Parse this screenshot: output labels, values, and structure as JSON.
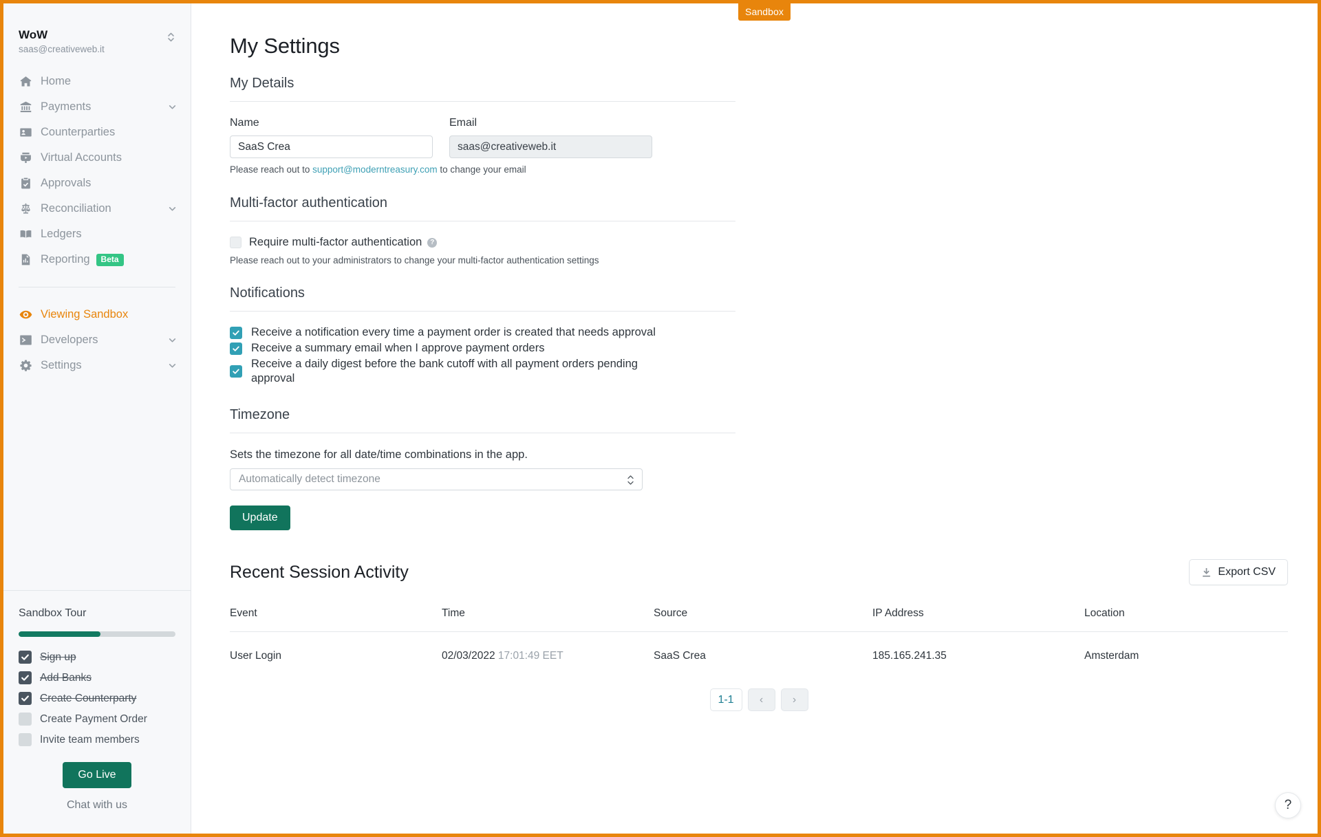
{
  "frame": {
    "sandbox_badge": "Sandbox",
    "accent_orange": "#e8850c",
    "accent_green": "#11745c",
    "accent_teal": "#31a0b5"
  },
  "sidebar": {
    "org": {
      "name": "WoW",
      "email": "saas@creativeweb.it"
    },
    "nav": [
      {
        "label": "Home",
        "icon": "home-icon",
        "chevron": false
      },
      {
        "label": "Payments",
        "icon": "bank-icon",
        "chevron": true
      },
      {
        "label": "Counterparties",
        "icon": "counterparties-icon",
        "chevron": false
      },
      {
        "label": "Virtual Accounts",
        "icon": "virtual-accounts-icon",
        "chevron": false
      },
      {
        "label": "Approvals",
        "icon": "clipboard-check-icon",
        "chevron": false
      },
      {
        "label": "Reconciliation",
        "icon": "scales-icon",
        "chevron": true
      },
      {
        "label": "Ledgers",
        "icon": "book-icon",
        "chevron": false
      },
      {
        "label": "Reporting",
        "icon": "report-icon",
        "chevron": false,
        "badge": "Beta"
      }
    ],
    "nav_secondary": [
      {
        "label": "Viewing Sandbox",
        "icon": "eye-icon",
        "chevron": false,
        "highlight": true
      },
      {
        "label": "Developers",
        "icon": "terminal-icon",
        "chevron": true
      },
      {
        "label": "Settings",
        "icon": "gear-icon",
        "chevron": true
      }
    ],
    "tour": {
      "title": "Sandbox Tour",
      "progress_percent": 52,
      "items": [
        {
          "label": "Sign up",
          "done": true
        },
        {
          "label": "Add Banks",
          "done": true
        },
        {
          "label": "Create Counterparty",
          "done": true
        },
        {
          "label": "Create Payment Order",
          "done": false
        },
        {
          "label": "Invite team members",
          "done": false
        }
      ],
      "go_live_label": "Go Live",
      "chat_label": "Chat with us"
    }
  },
  "main": {
    "page_title": "My Settings",
    "details": {
      "heading": "My Details",
      "name_label": "Name",
      "name_value": "SaaS Crea",
      "email_label": "Email",
      "email_value": "saas@creativeweb.it",
      "helper_prefix": "Please reach out to ",
      "helper_link": "support@moderntreasury.com",
      "helper_suffix": " to change your email"
    },
    "mfa": {
      "heading": "Multi-factor authentication",
      "checkbox_label": "Require multi-factor authentication",
      "checked": false,
      "help_glyph": "?",
      "helper": "Please reach out to your administrators to change your multi-factor authentication settings"
    },
    "notifications": {
      "heading": "Notifications",
      "items": [
        {
          "label": "Receive a notification every time a payment order is created that needs approval",
          "checked": true
        },
        {
          "label": "Receive a summary email when I approve payment orders",
          "checked": true
        },
        {
          "label": "Receive a daily digest before the bank cutoff with all payment orders pending approval",
          "checked": true
        }
      ]
    },
    "timezone": {
      "heading": "Timezone",
      "description": "Sets the timezone for all date/time combinations in the app.",
      "selected": "Automatically detect timezone"
    },
    "update_label": "Update",
    "activity": {
      "title": "Recent Session Activity",
      "export_label": "Export CSV",
      "columns": [
        "Event",
        "Time",
        "Source",
        "IP Address",
        "Location"
      ],
      "rows": [
        {
          "event": "User Login",
          "time_date": "02/03/2022",
          "time_clock": "17:01:49 EET",
          "source": "SaaS Crea",
          "ip": "185.165.241.35",
          "location": "Amsterdam"
        }
      ],
      "pagination": {
        "range": "1-1",
        "prev": "‹",
        "next": "›"
      }
    },
    "help_glyph": "?"
  }
}
